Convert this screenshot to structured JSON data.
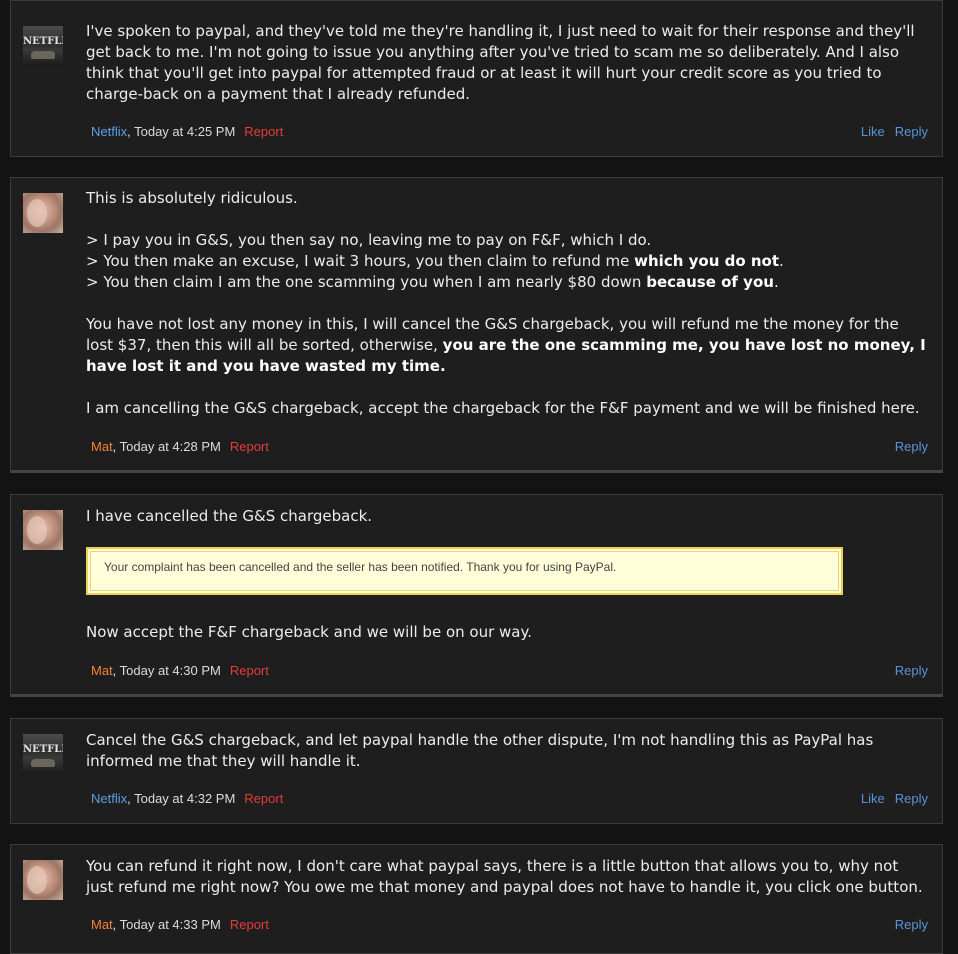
{
  "posts": [
    {
      "author": "Netflix",
      "time": ", Today at 4:25 PM",
      "report": "Report",
      "like": "Like",
      "reply": "Reply",
      "text": "I've spoken to paypal, and they've told me they're handling it, I just need to wait for their response and they'll get back to me. I'm not going to issue you anything after you've tried to scam me so deliberately. And I also think that you'll get into paypal for attempted fraud or at least it will hurt your credit score as you tried to charge-back on a payment that I already refunded."
    },
    {
      "author": "Mat",
      "time": ", Today at 4:28 PM",
      "report": "Report",
      "reply": "Reply",
      "p1": "This is absolutely ridiculous.",
      "l1": "> I pay you in G&S, you then say no, leaving me to pay on F&F, which I do.",
      "l2a": "> You then make an excuse, I wait 3 hours, you then claim to refund me ",
      "l2b": "which you do not",
      "l2c": ".",
      "l3a": "> You then claim I am the one scamming you when I am nearly $80 down ",
      "l3b": "because of you",
      "l3c": ".",
      "p3a": "You have not lost any money in this, I will cancel the G&S chargeback, you will refund me the money for the lost $37, then this will all be sorted, otherwise, ",
      "p3b": "you are the one scamming me, you have lost no money, I have lost it and you have wasted my time.",
      "p4": "I am cancelling the G&S chargeback, accept the chargeback for the F&F payment and we will be finished here."
    },
    {
      "author": "Mat",
      "time": ", Today at 4:30 PM",
      "report": "Report",
      "reply": "Reply",
      "p1": "I have cancelled the G&S chargeback.",
      "quote": "Your complaint has been cancelled and the seller has been notified. Thank you for using PayPal.",
      "p2": "Now accept the F&F chargeback and we will be on our way."
    },
    {
      "author": "Netflix",
      "time": ", Today at 4:32 PM",
      "report": "Report",
      "like": "Like",
      "reply": "Reply",
      "text": "Cancel the G&S chargeback, and let paypal handle the other dispute, I'm not handling this as PayPal has informed me that they will handle it."
    },
    {
      "author": "Mat",
      "time": ", Today at 4:33 PM",
      "report": "Report",
      "reply": "Reply",
      "text": "You can refund it right now, I don't care what paypal says, there is a little button that allows you to, why not just refund me right now? You owe me that money and paypal does not have to handle it, you click one button."
    }
  ],
  "avatars": {
    "netflix_logo": "NETFLIX"
  },
  "colors": {
    "background": "#131313",
    "post_bg": "#1e1e1e",
    "link_blue": "#5a94d6",
    "author_blue": "#5aa0e6",
    "author_orange": "#f0843c",
    "report_red": "#e43c3c",
    "quote_bg": "#fffed8",
    "quote_border": "#f0d050"
  }
}
